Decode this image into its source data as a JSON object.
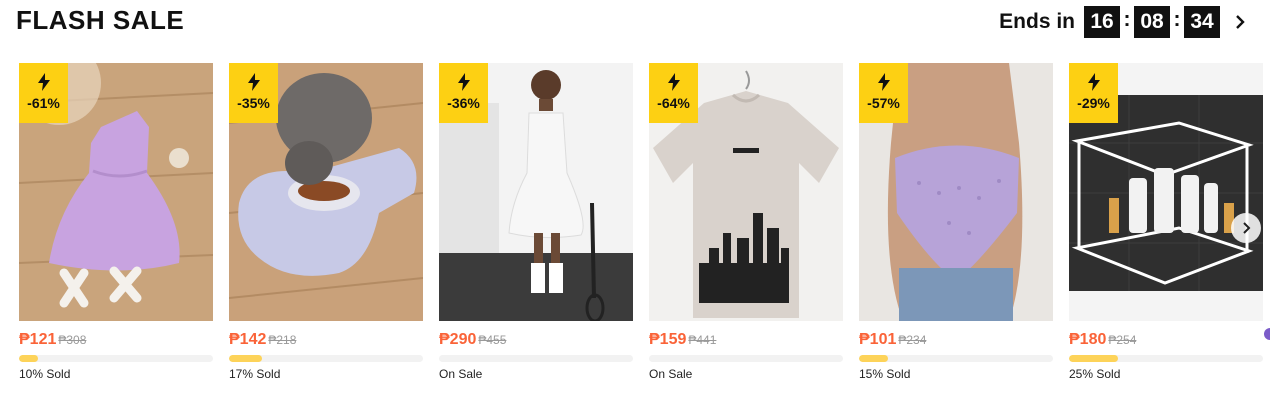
{
  "header": {
    "title": "FLASH SALE",
    "ends_label": "Ends in",
    "hours": "16",
    "minutes": "08",
    "seconds": "34",
    "separator": ":"
  },
  "colors": {
    "price": "#fa6338",
    "badge": "#fdd013",
    "progress": "#fdd359",
    "timer_box": "#111111"
  },
  "products": [
    {
      "discount": "-61%",
      "price": "₱121",
      "old_price": "₱308",
      "status": "10% Sold",
      "progress": 0.1,
      "image": "lavender-one-shoulder-dress-with-sandals"
    },
    {
      "discount": "-35%",
      "price": "₱142",
      "old_price": "₱218",
      "status": "17% Sold",
      "progress": 0.17,
      "image": "cat-eating-from-lavender-silicone-mat"
    },
    {
      "discount": "-36%",
      "price": "₱290",
      "old_price": "₱455",
      "status": "On Sale",
      "progress": 0.0,
      "image": "girl-in-white-tennis-dress"
    },
    {
      "discount": "-64%",
      "price": "₱159",
      "old_price": "₱441",
      "status": "On Sale",
      "progress": 0.0,
      "image": "beige-tshirt-city-print"
    },
    {
      "discount": "-57%",
      "price": "₱101",
      "old_price": "₱234",
      "status": "15% Sold",
      "progress": 0.15,
      "image": "lavender-eyelet-cami-top"
    },
    {
      "discount": "-29%",
      "price": "₱180",
      "old_price": "₱254",
      "status": "25% Sold",
      "progress": 0.25,
      "image": "white-corner-shower-caddy"
    }
  ],
  "icons": {
    "badge": "lightning-bolt-icon",
    "next": "chevron-right-icon",
    "slider_next": "chevron-right-icon"
  }
}
